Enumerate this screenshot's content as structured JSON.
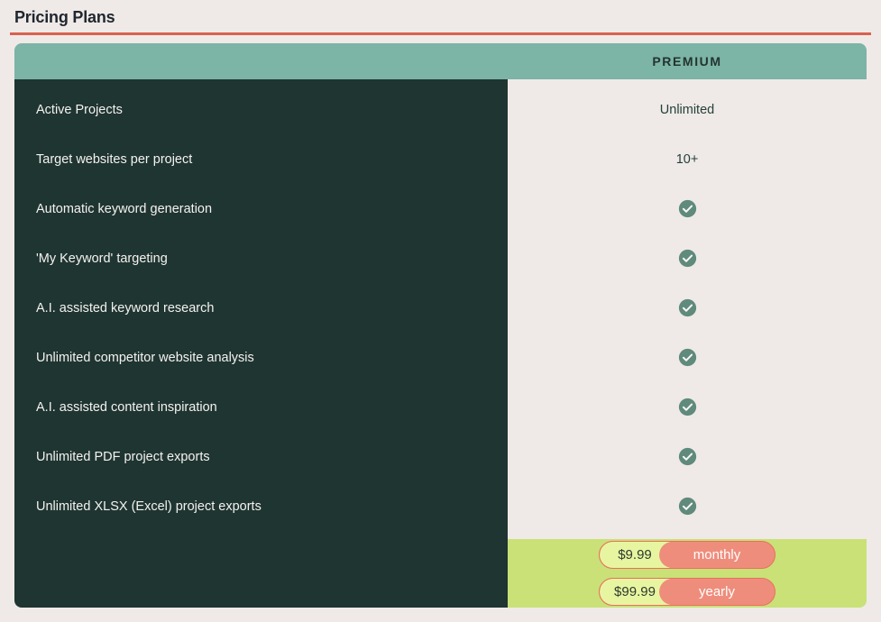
{
  "page": {
    "title": "Pricing Plans",
    "divider_color": "#d9614f"
  },
  "colors": {
    "header_band": "#7cb4a6",
    "feature_column": "#1f3531",
    "value_column": "#efeae7",
    "footer": "#c9e177",
    "price_chip": "#e8f5a0",
    "period_chip": "#ef8d7c",
    "check": "#5f8a7c"
  },
  "table": {
    "plan_header": "PREMIUM",
    "rows": [
      {
        "feature": "Active Projects",
        "value_type": "text",
        "value": "Unlimited"
      },
      {
        "feature": "Target websites per project",
        "value_type": "text",
        "value": "10+"
      },
      {
        "feature": "Automatic keyword generation",
        "value_type": "check",
        "value": "check-icon"
      },
      {
        "feature": "'My Keyword' targeting",
        "value_type": "check",
        "value": "check-icon"
      },
      {
        "feature": "A.I. assisted keyword research",
        "value_type": "check",
        "value": "check-icon"
      },
      {
        "feature": "Unlimited competitor website analysis",
        "value_type": "check",
        "value": "check-icon"
      },
      {
        "feature": "A.I. assisted content inspiration",
        "value_type": "check",
        "value": "check-icon"
      },
      {
        "feature": "Unlimited PDF project exports",
        "value_type": "check",
        "value": "check-icon"
      },
      {
        "feature": "Unlimited XLSX (Excel) project exports",
        "value_type": "check",
        "value": "check-icon"
      }
    ]
  },
  "pricing": {
    "options": [
      {
        "amount": "$9.99",
        "period": "monthly"
      },
      {
        "amount": "$99.99",
        "period": "yearly"
      }
    ]
  }
}
